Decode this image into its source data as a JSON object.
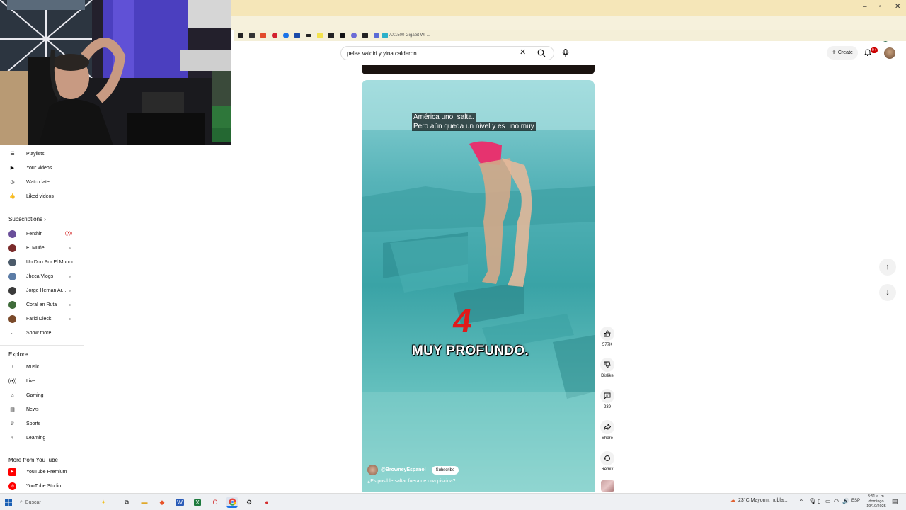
{
  "browser": {
    "window_controls": [
      "–",
      "▫",
      "✕"
    ],
    "bookmark_label": "AX1500 Gigabit Wi-..."
  },
  "youtube": {
    "search": {
      "query": "pelea valdiri y yina calderon",
      "clear": "✕"
    },
    "create_label": "Create",
    "notifications_badge": "9+"
  },
  "sidebar": {
    "you_items": [
      {
        "label": "Playlists",
        "icon": "playlist-icon"
      },
      {
        "label": "Your videos",
        "icon": "your-videos-icon"
      },
      {
        "label": "Watch later",
        "icon": "clock-icon"
      },
      {
        "label": "Liked videos",
        "icon": "thumbs-up-icon"
      }
    ],
    "subscriptions_title": "Subscriptions",
    "subscriptions": [
      {
        "label": "Fenthir",
        "color": "#6a4f9a",
        "live": true
      },
      {
        "label": "El Muñe",
        "color": "#7a2b2b"
      },
      {
        "label": "Un Duo Por El Mundo",
        "color": "#4c5b6a"
      },
      {
        "label": "Jheca Vlogs",
        "color": "#5c7ca6"
      },
      {
        "label": "Jorge Hernan Ar...",
        "color": "#3b3b3b"
      },
      {
        "label": "Coral en Ruta",
        "color": "#3f6b3a"
      },
      {
        "label": "Farid Dieck",
        "color": "#7a4a2a"
      }
    ],
    "show_more": "Show more",
    "explore_title": "Explore",
    "explore": [
      {
        "label": "Music",
        "icon": "music-note-icon"
      },
      {
        "label": "Live",
        "icon": "live-icon"
      },
      {
        "label": "Gaming",
        "icon": "gamepad-icon"
      },
      {
        "label": "News",
        "icon": "news-icon"
      },
      {
        "label": "Sports",
        "icon": "trophy-icon"
      },
      {
        "label": "Learning",
        "icon": "lightbulb-icon"
      }
    ],
    "more_title": "More from YouTube",
    "more": [
      {
        "label": "YouTube Premium",
        "color": "#ff0000"
      },
      {
        "label": "YouTube Studio",
        "color": "#ff0000"
      }
    ]
  },
  "short": {
    "caption_line1": "América uno, salta.",
    "caption_line2": "Pero aún queda un nivel y es uno muy",
    "big_number": "4",
    "big_text": "MUY PROFUNDO.",
    "channel": "@BrowneyEspanol",
    "subscribe": "Subscribe",
    "title": "¿Es posible saltar fuera de una piscina?",
    "actions": {
      "likes": "577K",
      "dislike": "Dislike",
      "comments": "239",
      "share": "Share",
      "remix": "Remix"
    }
  },
  "taskbar": {
    "search_placeholder": "Buscar",
    "weather": "23°C  Mayorm. nubla...",
    "lang": "ESP",
    "time": "3:51 a. m.",
    "day": "domingo",
    "date": "19/10/2025"
  }
}
